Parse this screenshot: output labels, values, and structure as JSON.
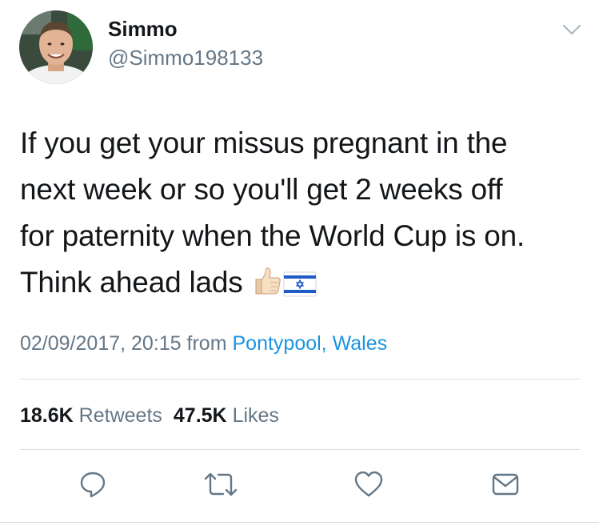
{
  "user": {
    "display_name": "Simmo",
    "handle": "@Simmo198133"
  },
  "tweet": {
    "lines": [
      "If you get your missus pregnant in the",
      "next week or so you'll get 2 weeks off",
      "for paternity when the World Cup is on.",
      "Think ahead lads "
    ],
    "emojis": [
      "thumbs-up-icon",
      "israel-flag-icon"
    ]
  },
  "meta": {
    "timestamp": "02/09/2017, 20:15",
    "from_label": " from ",
    "location": "Pontypool, Wales"
  },
  "stats": {
    "retweets_count": "18.6K",
    "retweets_label": "Retweets",
    "likes_count": "47.5K",
    "likes_label": "Likes"
  },
  "actions": [
    "reply-icon",
    "retweet-icon",
    "like-icon",
    "share-icon"
  ],
  "colors": {
    "text": "#14171a",
    "secondary": "#657786",
    "link": "#1b95e0",
    "divider": "#d8dde1"
  }
}
